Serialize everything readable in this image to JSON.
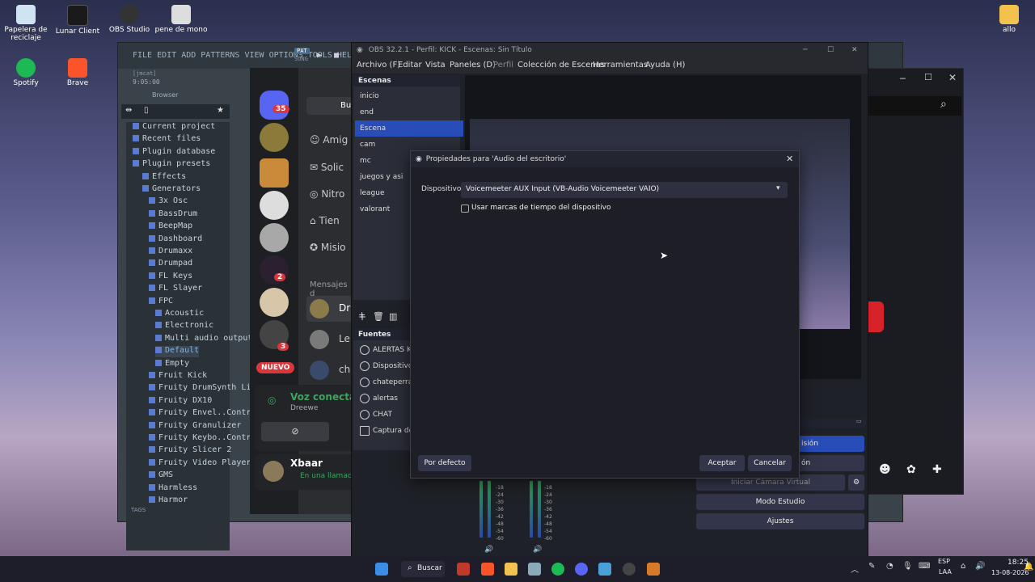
{
  "desktop": {
    "icons": [
      {
        "label": "Papelera de reciclaje",
        "color": "#cfe3f2"
      },
      {
        "label": "Lunar Client",
        "color": "#1a1a1a"
      },
      {
        "label": "OBS Studio",
        "color": "#333"
      },
      {
        "label": "pene de mono",
        "color": "#ddd"
      },
      {
        "label": "Spotify",
        "color": "#1db954"
      },
      {
        "label": "Brave",
        "color": "#fb542b"
      }
    ],
    "folder_label": "allo"
  },
  "fl_studio": {
    "menu": "FILE EDIT ADD PATTERNS VIEW OPTIONS TOOLS HELP",
    "pat_label": "PAT",
    "song_label": "SONG",
    "time_label": "[jmcat]",
    "time": "9:05:00",
    "browser_label": "Browser",
    "tags_label": "TAGS",
    "tree": [
      "Current project",
      "Recent files",
      "Plugin database",
      "Plugin presets",
      "Effects",
      "Generators",
      "3x Osc",
      "BassDrum",
      "BeepMap",
      "Dashboard",
      "Drumaxx",
      "Drumpad",
      "FL Keys",
      "FL Slayer",
      "FPC",
      "Acoustic",
      "Electronic",
      "Multi audio output",
      "Default",
      "Empty",
      "Fruit Kick",
      "Fruity DrumSynth Live",
      "Fruity DX10",
      "Fruity Envel..Controller",
      "Fruity Granulizer",
      "Fruity Keybo..Controller",
      "Fruity Slicer 2",
      "Fruity Video Player",
      "GMS",
      "Harmless",
      "Harmor"
    ]
  },
  "discord": {
    "badges": [
      "35",
      "2",
      "3"
    ],
    "new_label": "NUEVO",
    "menu": [
      {
        "icon": "friends-icon",
        "label": "Amig"
      },
      {
        "icon": "requests-icon",
        "label": "Solic"
      },
      {
        "icon": "nitro-icon",
        "label": "Nitro"
      },
      {
        "icon": "shop-icon",
        "label": "Tien"
      },
      {
        "icon": "missions-icon",
        "label": "Misio"
      }
    ],
    "search_btn": "Bu",
    "messages_header": "Mensajes d",
    "dms": [
      "Dr",
      "Le",
      "ch"
    ],
    "voice_status": "Voz conectad",
    "voice_channel": "Dreewe",
    "user_name": "Xbaar",
    "user_status": "En una llamad"
  },
  "obs": {
    "title": "OBS 32.2.1 - Perfil: KICK - Escenas: Sin Título",
    "menu": [
      "Archivo (F)",
      "Editar",
      "Vista",
      "Paneles (D)",
      "Perfil",
      "Colección de Escenas",
      "Herramientas",
      "Ayuda (H)"
    ],
    "scenes_header": "Escenas",
    "scenes": [
      "inicio",
      "end",
      "Escena",
      "cam",
      "mc",
      "juegos y asi",
      "league",
      "valorant"
    ],
    "sources_header": "Fuentes",
    "sources": [
      "ALERTAS KICK",
      "Dispositivo d",
      "chateperra",
      "alertas",
      "CHAT",
      "Captura de p"
    ],
    "controls": [
      "Iniciar Cámara Virtual",
      "Modo Estudio",
      "Ajustes"
    ],
    "partial_controls": [
      "isión",
      "ón"
    ],
    "meter_ticks": [
      "-18",
      "-24",
      "-30",
      "-36",
      "-42",
      "-48",
      "-54",
      "-60"
    ]
  },
  "dialog": {
    "title": "Propiedades para 'Audio del escritorio'",
    "device_label": "Dispositivo",
    "device_value": "Voicemeeter AUX Input (VB-Audio Voicemeeter VAIO)",
    "checkbox_label": "Usar marcas de tiempo del dispositivo",
    "default_btn": "Por defecto",
    "ok_btn": "Aceptar",
    "cancel_btn": "Cancelar"
  },
  "taskbar": {
    "search_label": "Buscar",
    "lang_top": "ESP",
    "lang_bottom": "LAA",
    "time": "18:25",
    "date": "13-08-2026"
  }
}
